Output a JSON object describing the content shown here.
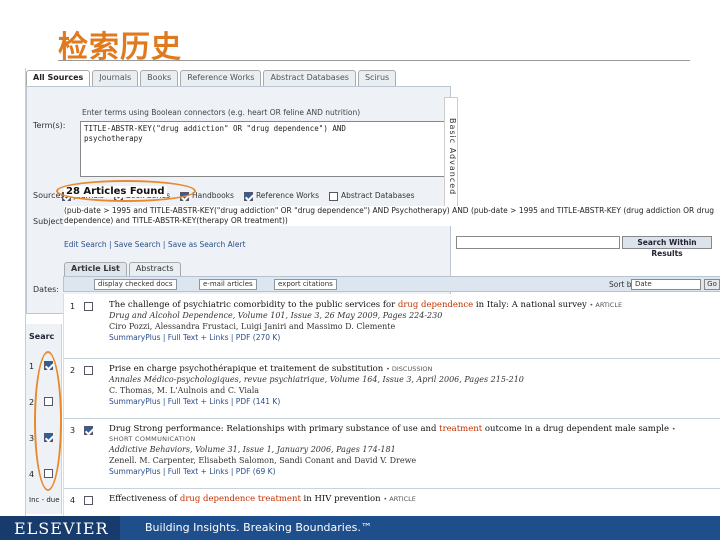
{
  "slide": {
    "title": "检索历史",
    "footer_brand": "ELSEVIER",
    "footer_tagline": "Building Insights. Breaking Boundaries.™"
  },
  "top_tabs": [
    "All Sources",
    "Journals",
    "Books",
    "Reference Works",
    "Abstract Databases",
    "Scirus"
  ],
  "search_form": {
    "hint": "Enter terms using Boolean connectors (e.g. heart OR feline AND nutrition)",
    "terms_label": "Term(s):",
    "terms_value": "TITLE-ABSTR-KEY(\"drug addiction\" OR \"drug dependence\") AND\npsychotherapy",
    "side_label": "Basic\nAdvanced",
    "sources_label": "Sources:",
    "sources": [
      {
        "label": "Journals",
        "checked": true
      },
      {
        "label": "Book Series",
        "checked": true
      },
      {
        "label": "Handbooks",
        "checked": true
      },
      {
        "label": "Reference Works",
        "checked": true
      },
      {
        "label": "Abstract Databases",
        "checked": false
      }
    ],
    "subject_label": "Subject",
    "dates_label": "Dates:"
  },
  "results": {
    "found_text": "28 Articles Found",
    "query_text": "(pub-date > 1995 and TITLE-ABSTR-KEY(\"drug addiction\" OR \"drug dependence\") AND Psychotherapy) AND (pub-date > 1995 and TITLE-ABSTR-KEY (drug addiction OR drug dependence) and TITLE-ABSTR-KEY(therapy OR treatment))",
    "actions": "Edit Search | Save Search | Save as Search Alert",
    "search_within_button": "Search Within Results",
    "tabs": [
      "Article List",
      "Abstracts"
    ],
    "toolbar": {
      "display": "display checked docs",
      "email": "e-mail articles",
      "export": "export citations",
      "sort_label": "Sort by:",
      "sort_value": "Date",
      "go": "Go"
    },
    "items": [
      {
        "num": "1",
        "checked": false,
        "pre": "The challenge of psychiatric comorbidity to the public services for ",
        "highlight": "drug dependence",
        "post": " in Italy: A national survey",
        "kind": "• ARTICLE",
        "section": "",
        "meta": "Drug and Alcohol Dependence, Volume 101, Issue 3, 26 May 2009, Pages 224-230",
        "authors": "Ciro Pozzi, Alessandra Frustaci, Luigi Janiri and Massimo D. Clemente",
        "links": "SummaryPlus | Full Text + Links | PDF (270 K)"
      },
      {
        "num": "2",
        "checked": false,
        "pre": "Prise en charge psychothérapique et traitement de substitution",
        "highlight": "",
        "post": "",
        "kind": "• DISCUSSION",
        "section": "",
        "meta": "Annales Médico-psychologiques, revue psychiatrique, Volume 164, Issue 3, April 2006, Pages 215-210",
        "authors": "C. Thomas, M. L'Aulnois and C. Viala",
        "links": "SummaryPlus | Full Text + Links | PDF (141 K)"
      },
      {
        "num": "3",
        "checked": true,
        "pre": "Drug Strong performance: Relationships with primary substance of use and ",
        "highlight": "treatment",
        "post": " outcome in a drug dependent male sample",
        "kind": "•",
        "section": "SHORT COMMUNICATION",
        "meta": "Addictive Behaviors, Volume 31, Issue 1, January 2006, Pages 174-181",
        "authors": "Zenell. M. Carpenter, Elisabeth Salomon, Sandi Conant and David V. Drewe",
        "links": "SummaryPlus | Full Text + Links | PDF (69 K)"
      },
      {
        "num": "4",
        "checked": false,
        "pre": "Effectiveness of ",
        "highlight": "drug dependence treatment",
        "post": " in HIV prevention",
        "kind": "• ARTICLE",
        "section": "",
        "meta": "",
        "authors": "",
        "links": ""
      }
    ]
  },
  "left_strip": {
    "head": "Searc",
    "nums": [
      "1",
      "2",
      "3",
      "4"
    ],
    "checks": [
      true,
      false,
      true,
      false
    ],
    "footer_text": "Inc - due"
  },
  "colors": {
    "title": "#e07a1f",
    "highlight": "#c23000",
    "annotation": "#e8892b",
    "footer": "#1f4e8c"
  }
}
